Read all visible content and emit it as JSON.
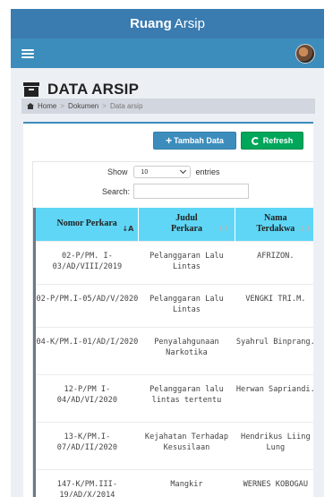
{
  "app": {
    "brand_bold": "Ruang",
    "brand_rest": "Arsip"
  },
  "page": {
    "title": "DATA ARSIP",
    "breadcrumb": [
      "Home",
      "Dokumen",
      "Data arsip"
    ]
  },
  "toolbar": {
    "add_label": "Tambah Data",
    "refresh_label": "Refresh"
  },
  "datatable": {
    "show_label": "Show",
    "entries_value": "10",
    "entries_label": "entries",
    "search_label": "Search:",
    "search_value": "",
    "columns": [
      "Nomor Perkara",
      "Judul Perkara",
      "Nama Terdakwa"
    ],
    "rows": [
      [
        "02-P/PM. I-03/AD/VIII/2019",
        "Pelanggaran Lalu Lintas",
        "AFRIZON."
      ],
      [
        "02-P/PM.I-05/AD/V/2020",
        "Pelanggaran Lalu Lintas",
        "VENGKI TRI.M."
      ],
      [
        "04-K/PM.I-01/AD/I/2020",
        "Penyalahgunaan Narkotika",
        "Syahrul Binprang."
      ],
      [
        "12-P/PM I-04/AD/VI/2020",
        "Pelanggaran lalu lintas tertentu",
        "Herwan Sapriandi."
      ],
      [
        "13-K/PM.I-07/AD/II/2020",
        "Kejahatan Terhadap Kesusilaan",
        "Hendrikus Liing Lung"
      ],
      [
        "147-K/PM.III-19/AD/X/2014",
        "Mangkir",
        "WERNES KOBOGAU"
      ]
    ]
  },
  "colors": {
    "topbar": "#3a7bb0",
    "navbar": "#3c8dbc",
    "add_button": "#3c8dbc",
    "refresh_button": "#00a65a",
    "table_header": "#5fd6f5"
  },
  "icons": [
    "menu-icon",
    "user-avatar",
    "archive-icon",
    "home-icon",
    "plus-icon",
    "refresh-icon",
    "chevron-down-icon",
    "sort-icon"
  ]
}
